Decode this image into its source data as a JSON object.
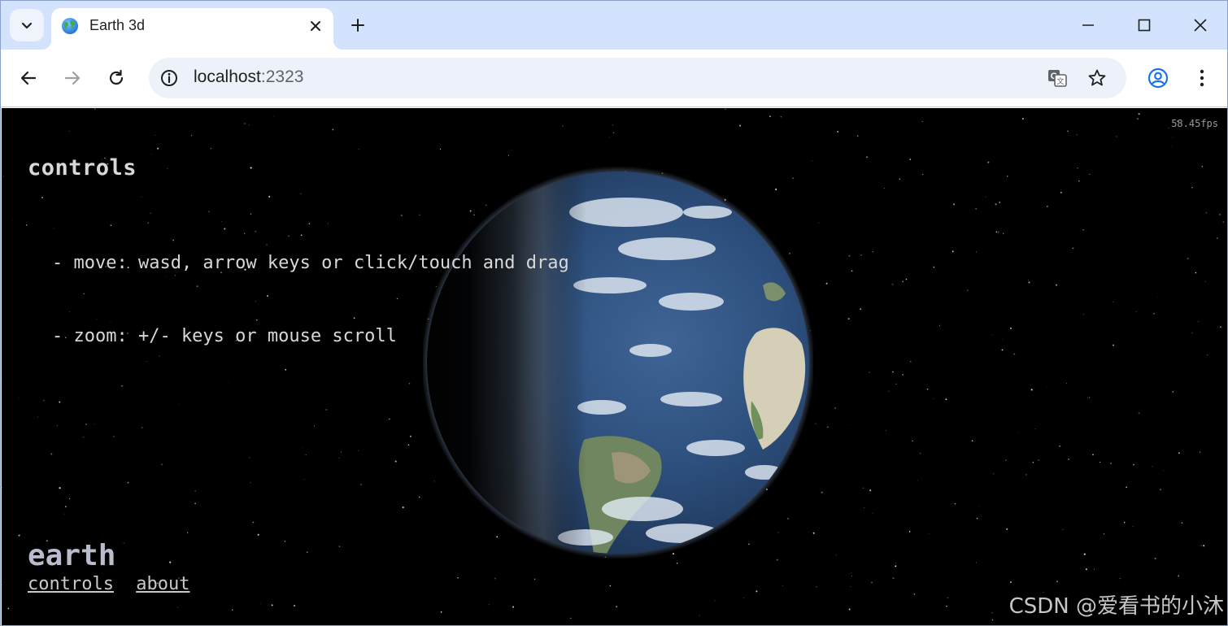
{
  "browser": {
    "tab": {
      "title": "Earth 3d",
      "favicon": "globe-emoji"
    },
    "url": {
      "host": "localhost",
      "port": ":2323"
    },
    "icons": {
      "tab_search": "chevron-down-icon",
      "close_tab": "close-icon",
      "new_tab": "plus-icon",
      "minimize": "minimize-icon",
      "maximize": "maximize-icon",
      "close_window": "close-icon",
      "back": "arrow-left-icon",
      "forward": "arrow-right-icon",
      "reload": "reload-icon",
      "site_info": "info-icon",
      "translate": "translate-icon",
      "bookmark": "star-icon",
      "profile": "profile-icon",
      "menu": "kebab-menu-icon"
    }
  },
  "page": {
    "fps": "58.45fps",
    "controls": {
      "title": "controls",
      "items": [
        "- move: wasd, arrow keys or click/touch and drag",
        "- zoom: +/- keys or mouse scroll"
      ]
    },
    "planet_name": "earth",
    "links": [
      "controls",
      "about"
    ],
    "watermark": "CSDN @爱看书的小沐"
  },
  "colors": {
    "tabstrip": "#d3e3fd",
    "omnibox": "#edf2fa",
    "page_background": "#000000",
    "ocean": "#2d4f7d",
    "land_desert": "#d6cfb8"
  }
}
